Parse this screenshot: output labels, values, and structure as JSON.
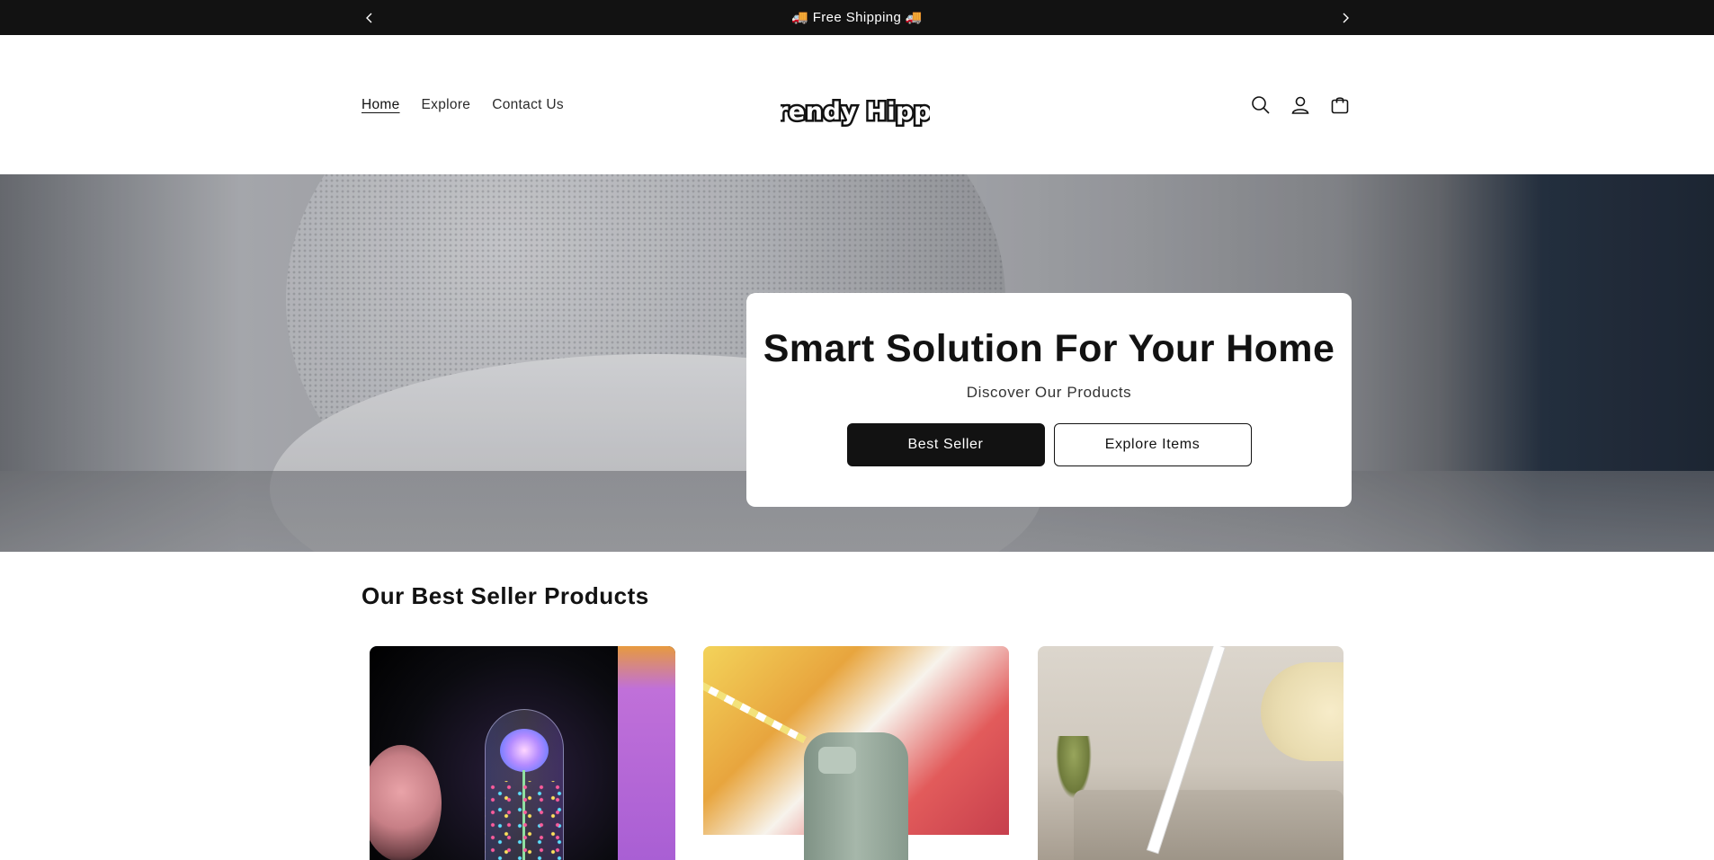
{
  "announcement": {
    "text": "🚚 Free Shipping 🚚",
    "prev_icon": "chevron-left-icon",
    "next_icon": "chevron-right-icon"
  },
  "header": {
    "nav": [
      {
        "label": "Home",
        "active": true
      },
      {
        "label": "Explore",
        "active": false
      },
      {
        "label": "Contact Us",
        "active": false
      }
    ],
    "logo_text": "Trendy Hippo",
    "icons": [
      "search-icon",
      "account-icon",
      "cart-icon"
    ]
  },
  "hero": {
    "title": "Smart Solution For Your Home",
    "subtitle": "Discover Our Products",
    "primary_button": "Best Seller",
    "secondary_button": "Explore Items"
  },
  "products": {
    "section_title": "Our Best Seller Products"
  },
  "colors": {
    "announcement_bg": "#121212",
    "primary_button_bg": "#121212",
    "text": "#121212"
  }
}
